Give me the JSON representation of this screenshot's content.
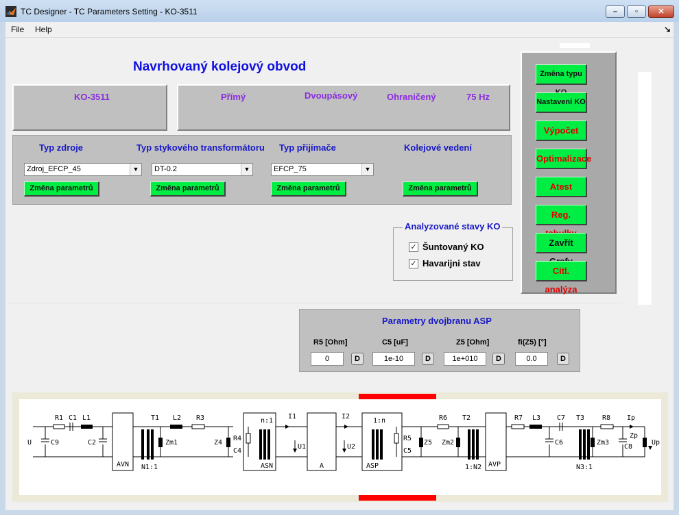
{
  "window": {
    "title": "TC Designer - TC Parameters Setting - KO-3511",
    "minimize": "–",
    "maximize": "▫",
    "close": "✕"
  },
  "menu": {
    "file": "File",
    "help": "Help"
  },
  "main_title": "Navrhovaný kolejový obvod",
  "summary": {
    "name": "KO-3511",
    "type": "Přímý",
    "rail": "Dvoupásový",
    "limit": "Ohraničený",
    "freq": "75 Hz"
  },
  "config": {
    "source_label": "Typ zdroje",
    "transformer_label": "Typ stykového transformátoru",
    "receiver_label": "Typ přijímače",
    "line_label": "Kolejové vedení",
    "source_value": "Zdroj_EFCP_45",
    "transformer_value": "DT-0.2",
    "receiver_value": "EFCP_75",
    "change_params": "Změna parametrů"
  },
  "states": {
    "legend": "Analyzované stavy KO",
    "shunt_label": "Šuntovaný KO",
    "shunt_checked": "✓",
    "emergency_label": "Havarijni stav",
    "emergency_checked": "✓"
  },
  "right_buttons": {
    "change_type": "Změna typu KO",
    "settings": "Nastavení KO",
    "compute": "Výpočet",
    "optimize": "Optimalizace",
    "atest": "Atest",
    "reg_tables": "Reg. tabulky",
    "close_graphs": "Zavřít Grafy",
    "sensitivity": "Citl. analýza"
  },
  "asp": {
    "title": "Parametry dvojbranu ASP",
    "r5_label": "R5 [Ohm]",
    "c5_label": "C5 [uF]",
    "z5_label": "Z5 [Ohm]",
    "fi_label": "fi(Z5) [°]",
    "r5_value": "0",
    "c5_value": "1e-10",
    "z5_value": "1e+010",
    "fi_value": "0.0",
    "d_label": "D"
  },
  "circuit": {
    "U": "U",
    "C9": "C9",
    "R1": "R1",
    "C1": "C1",
    "L1": "L1",
    "C2": "C2",
    "AVN": "AVN",
    "T1": "T1",
    "Zm1": "Zm1",
    "N1_1": "N1:1",
    "L2": "L2",
    "R3": "R3",
    "Z4": "Z4",
    "R4": "R4",
    "C4": "C4",
    "n1": "n:1",
    "ASN": "ASN",
    "I1": "I1",
    "U1": "U1",
    "A": "A",
    "I2": "I2",
    "U2": "U2",
    "one_n": "1:n",
    "R5": "R5",
    "C5": "C5",
    "Z5": "Z5",
    "ASP": "ASP",
    "R6": "R6",
    "T2": "T2",
    "Zm2": "Zm2",
    "one_N2": "1:N2",
    "AVP": "AVP",
    "R7": "R7",
    "L3": "L3",
    "C7": "C7",
    "C6": "C6",
    "T3": "T3",
    "R8": "R8",
    "Zm3": "Zm3",
    "N3_1": "N3:1",
    "Ip": "Ip",
    "Zp": "Zp",
    "C8": "C8",
    "Up": "Up"
  },
  "colors": {
    "green_button": "#00ee44",
    "red_text": "#e00000",
    "blue_heading": "#1010e0",
    "purple_text": "#8a2be2",
    "red_marker": "#ff0000"
  }
}
